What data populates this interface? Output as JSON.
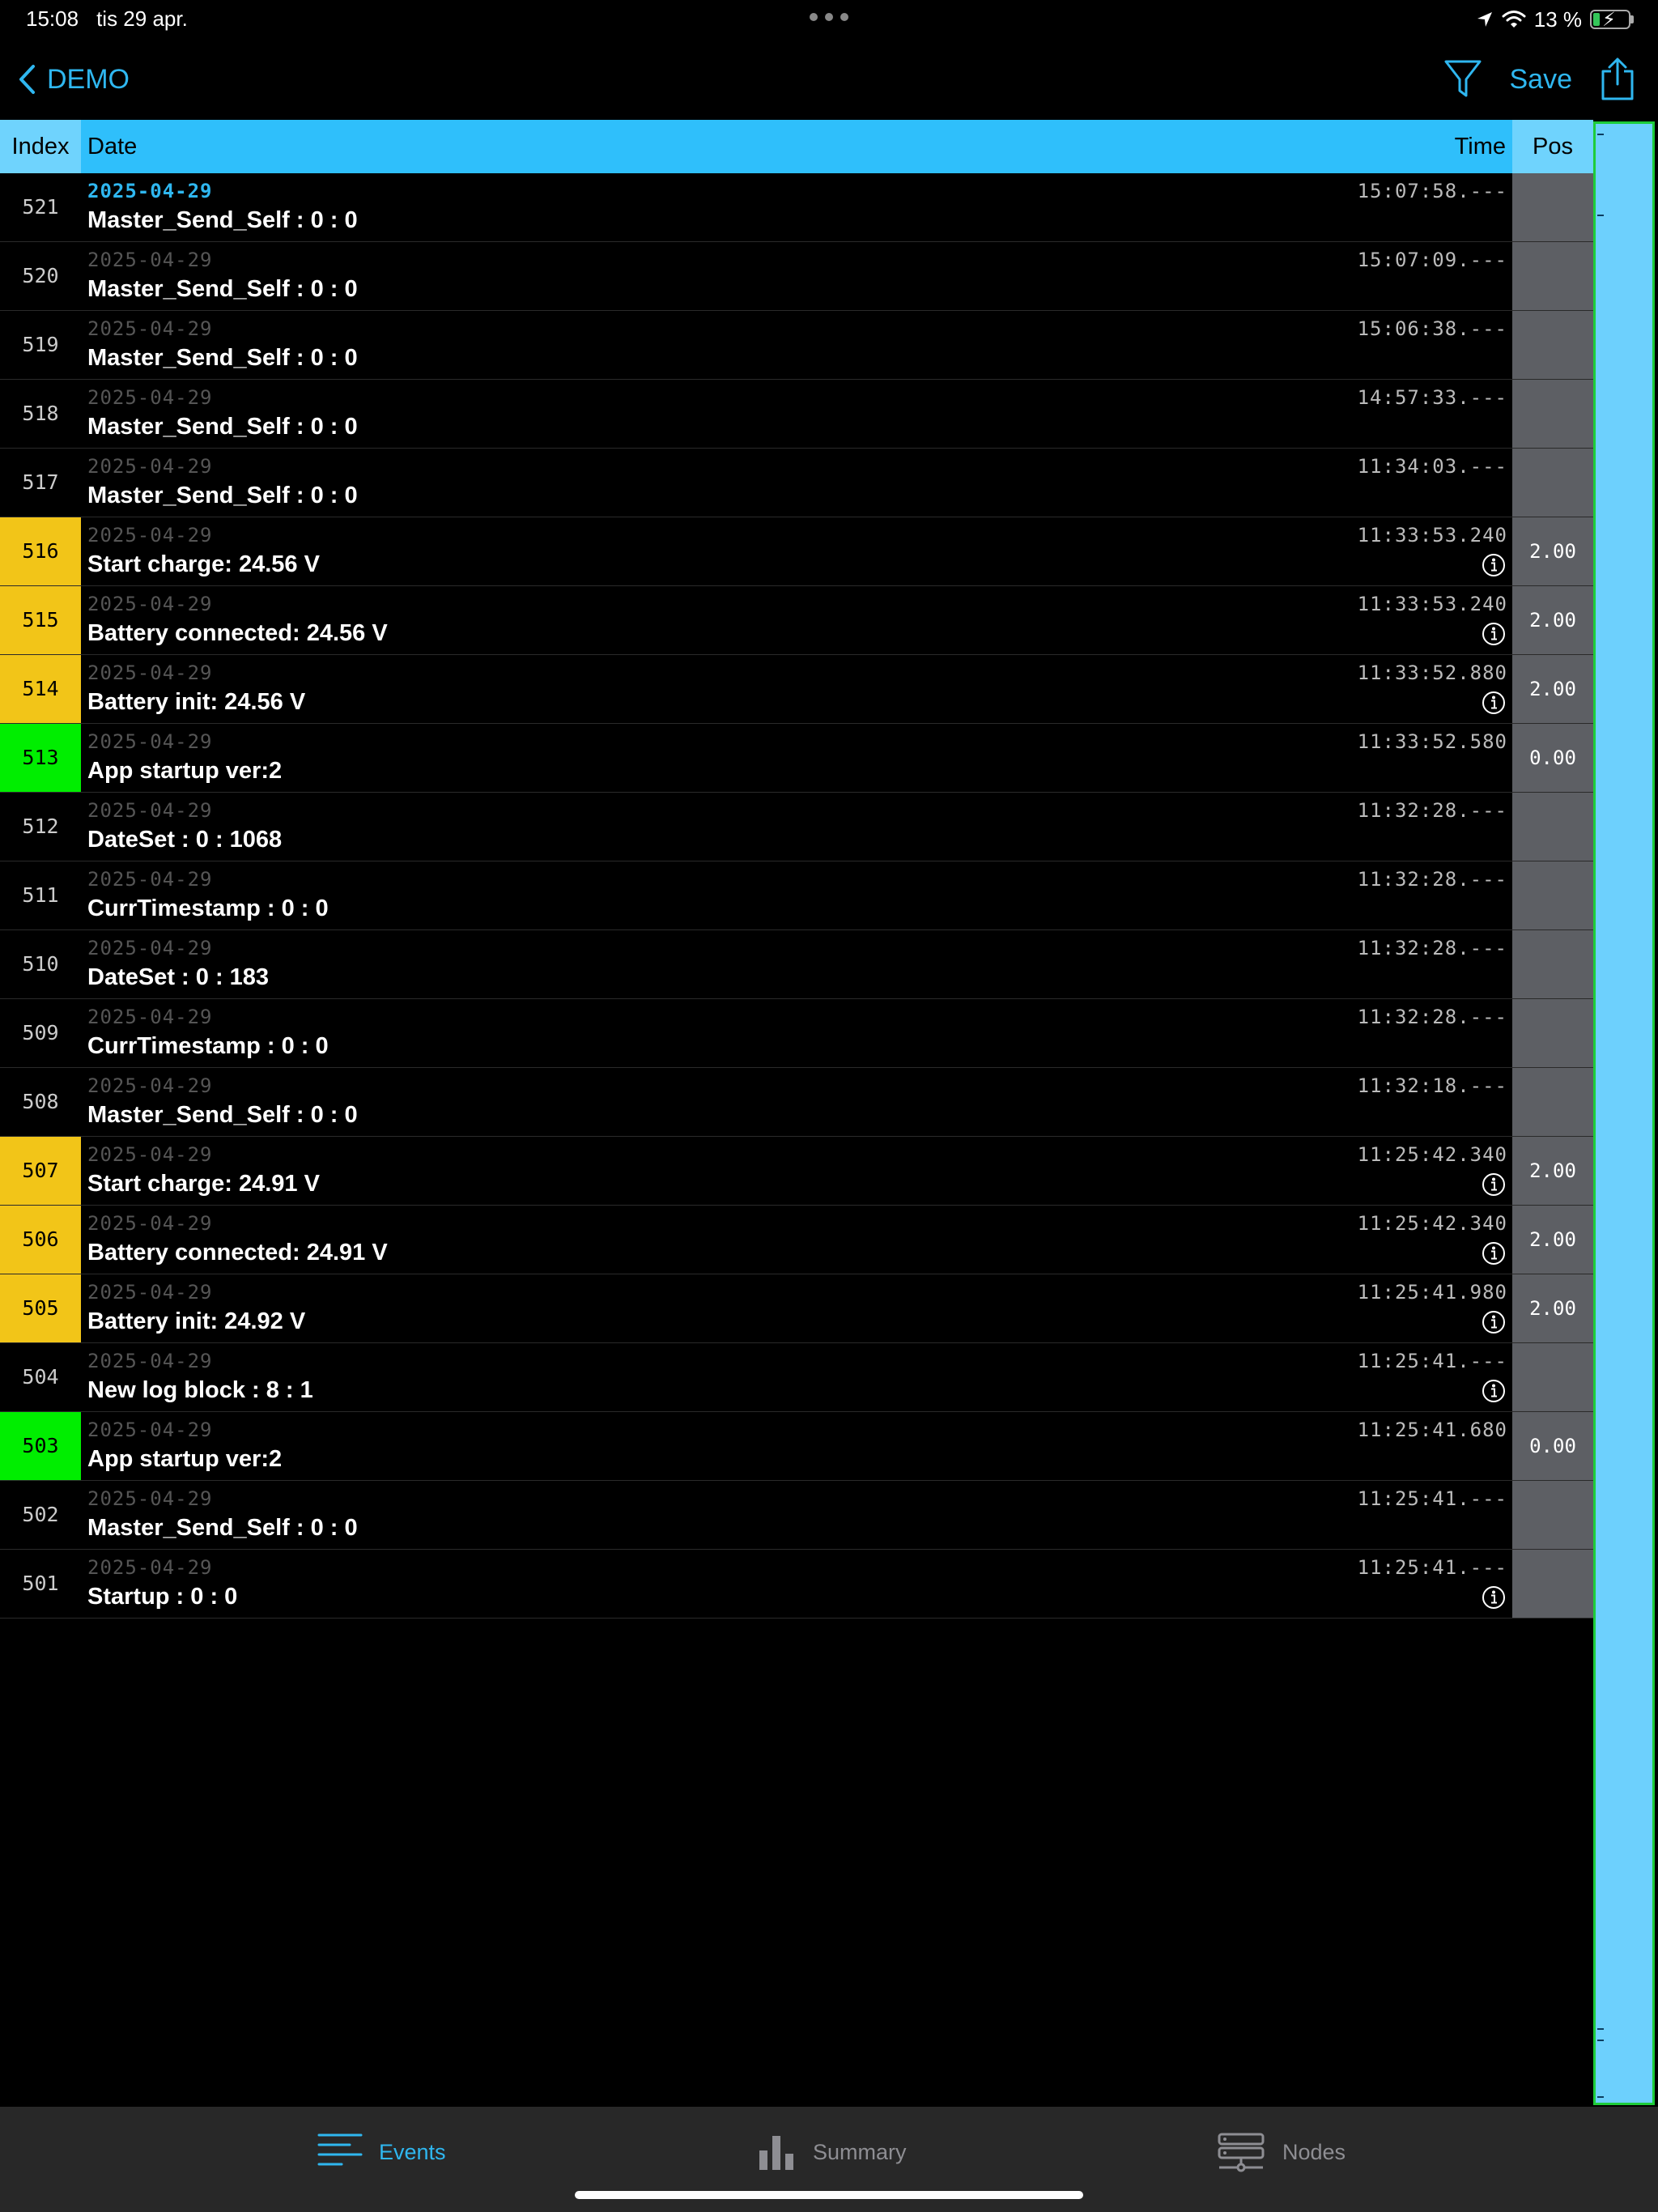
{
  "status_bar": {
    "time": "15:08",
    "date": "tis 29 apr.",
    "battery_percent": "13 %",
    "battery_level": 0.13
  },
  "nav": {
    "back_label": "DEMO",
    "save_label": "Save"
  },
  "table": {
    "headers": {
      "index": "Index",
      "date": "Date",
      "time": "Time",
      "pos": "Pos"
    },
    "rows": [
      {
        "index": "521",
        "date": "2025-04-29",
        "text": "Master_Send_Self : 0 : 0",
        "time": "15:07:58.---",
        "pos": "",
        "info": false,
        "color": "none"
      },
      {
        "index": "520",
        "date": "2025-04-29",
        "text": "Master_Send_Self : 0 : 0",
        "time": "15:07:09.---",
        "pos": "",
        "info": false,
        "color": "none"
      },
      {
        "index": "519",
        "date": "2025-04-29",
        "text": "Master_Send_Self : 0 : 0",
        "time": "15:06:38.---",
        "pos": "",
        "info": false,
        "color": "none"
      },
      {
        "index": "518",
        "date": "2025-04-29",
        "text": "Master_Send_Self : 0 : 0",
        "time": "14:57:33.---",
        "pos": "",
        "info": false,
        "color": "none"
      },
      {
        "index": "517",
        "date": "2025-04-29",
        "text": "Master_Send_Self : 0 : 0",
        "time": "11:34:03.---",
        "pos": "",
        "info": false,
        "color": "none"
      },
      {
        "index": "516",
        "date": "2025-04-29",
        "text": "Start charge: 24.56 V",
        "time": "11:33:53.240",
        "pos": "2.00",
        "info": true,
        "color": "yellow"
      },
      {
        "index": "515",
        "date": "2025-04-29",
        "text": "Battery connected: 24.56 V",
        "time": "11:33:53.240",
        "pos": "2.00",
        "info": true,
        "color": "yellow"
      },
      {
        "index": "514",
        "date": "2025-04-29",
        "text": "Battery init: 24.56 V",
        "time": "11:33:52.880",
        "pos": "2.00",
        "info": true,
        "color": "yellow"
      },
      {
        "index": "513",
        "date": "2025-04-29",
        "text": "App startup ver:2",
        "time": "11:33:52.580",
        "pos": "0.00",
        "info": false,
        "color": "green"
      },
      {
        "index": "512",
        "date": "2025-04-29",
        "text": "DateSet : 0 : 1068",
        "time": "11:32:28.---",
        "pos": "",
        "info": false,
        "color": "none"
      },
      {
        "index": "511",
        "date": "2025-04-29",
        "text": "CurrTimestamp : 0 : 0",
        "time": "11:32:28.---",
        "pos": "",
        "info": false,
        "color": "none"
      },
      {
        "index": "510",
        "date": "2025-04-29",
        "text": "DateSet : 0 : 183",
        "time": "11:32:28.---",
        "pos": "",
        "info": false,
        "color": "none"
      },
      {
        "index": "509",
        "date": "2025-04-29",
        "text": "CurrTimestamp : 0 : 0",
        "time": "11:32:28.---",
        "pos": "",
        "info": false,
        "color": "none"
      },
      {
        "index": "508",
        "date": "2025-04-29",
        "text": "Master_Send_Self : 0 : 0",
        "time": "11:32:18.---",
        "pos": "",
        "info": false,
        "color": "none"
      },
      {
        "index": "507",
        "date": "2025-04-29",
        "text": "Start charge: 24.91 V",
        "time": "11:25:42.340",
        "pos": "2.00",
        "info": true,
        "color": "yellow"
      },
      {
        "index": "506",
        "date": "2025-04-29",
        "text": "Battery connected: 24.91 V",
        "time": "11:25:42.340",
        "pos": "2.00",
        "info": true,
        "color": "yellow"
      },
      {
        "index": "505",
        "date": "2025-04-29",
        "text": "Battery init: 24.92 V",
        "time": "11:25:41.980",
        "pos": "2.00",
        "info": true,
        "color": "yellow"
      },
      {
        "index": "504",
        "date": "2025-04-29",
        "text": "New log block : 8 : 1",
        "time": "11:25:41.---",
        "pos": "",
        "info": true,
        "color": "none"
      },
      {
        "index": "503",
        "date": "2025-04-29",
        "text": "App startup ver:2",
        "time": "11:25:41.680",
        "pos": "0.00",
        "info": false,
        "color": "green"
      },
      {
        "index": "502",
        "date": "2025-04-29",
        "text": "Master_Send_Self : 0 : 0",
        "time": "11:25:41.---",
        "pos": "",
        "info": false,
        "color": "none"
      },
      {
        "index": "501",
        "date": "2025-04-29",
        "text": "Startup : 0 : 0",
        "time": "11:25:41.---",
        "pos": "",
        "info": true,
        "color": "none"
      }
    ]
  },
  "tabs": [
    {
      "label": "Events",
      "icon": "list-icon",
      "active": true
    },
    {
      "label": "Summary",
      "icon": "bar-chart-icon",
      "active": false
    },
    {
      "label": "Nodes",
      "icon": "network-icon",
      "active": false
    }
  ],
  "colors": {
    "accent": "#2fb7f0",
    "header_bg": "#2fbffb",
    "row_yellow": "#f2c518",
    "row_green": "#00ee00",
    "pos_column_bg": "#5d5f64",
    "strip_bg": "#6dd0fd",
    "strip_border": "#1ecc3a"
  }
}
